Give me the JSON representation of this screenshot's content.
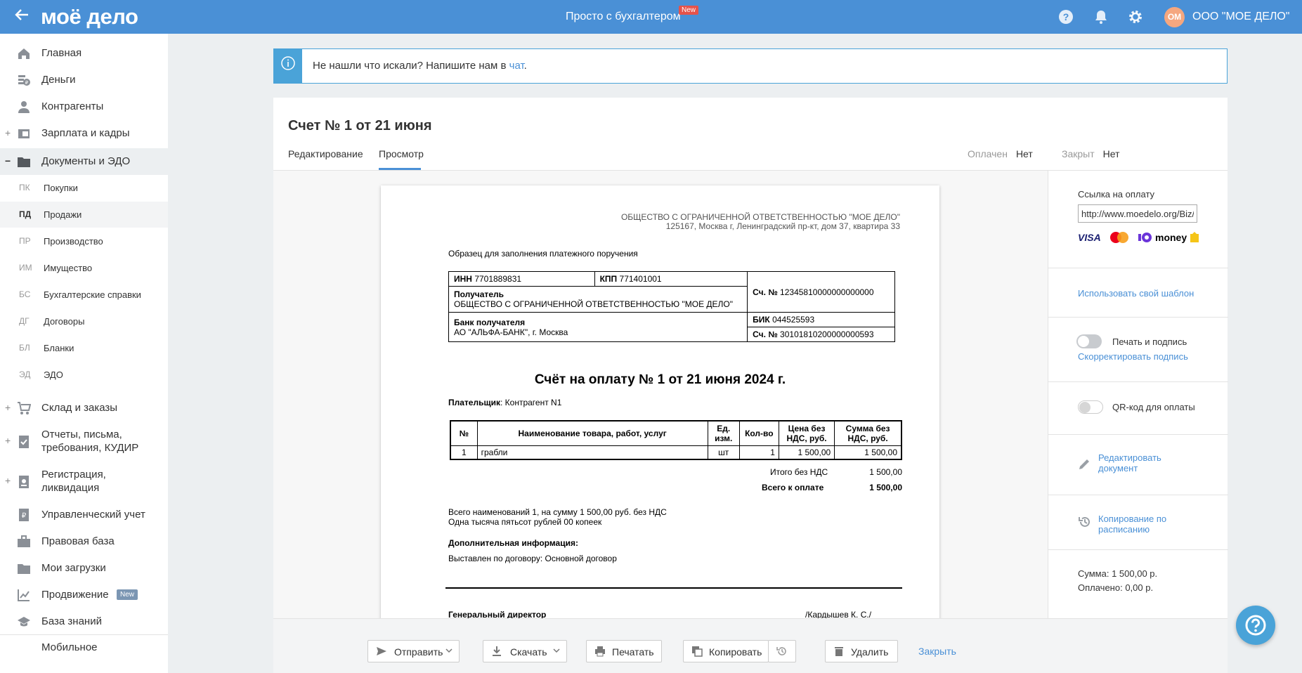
{
  "topbar": {
    "logo": "моё дело",
    "center_text": "Просто с бухгалтером",
    "new_badge": "New",
    "avatar_initials": "ОМ",
    "company": "ООО \"МОЕ ДЕЛО\""
  },
  "sidebar": {
    "items": [
      {
        "label": "Главная"
      },
      {
        "label": "Деньги"
      },
      {
        "label": "Контрагенты"
      },
      {
        "label": "Зарплата и кадры",
        "expander": "+"
      },
      {
        "label": "Документы и ЭДО",
        "expander": "−"
      },
      {
        "label": "Склад и заказы",
        "expander": "+"
      },
      {
        "label_line1": "Отчеты, письма,",
        "label_line2": "требования, КУДИР",
        "expander": "+"
      },
      {
        "label_line1": "Регистрация,",
        "label_line2": "ликвидация",
        "expander": "+"
      },
      {
        "label": "Управленческий учет"
      },
      {
        "label": "Правовая база"
      },
      {
        "label": "Мои загрузки"
      },
      {
        "label": "Продвижение",
        "badge": "New"
      },
      {
        "label": "База знаний"
      },
      {
        "label": "Мобильное"
      }
    ],
    "sub_items": [
      {
        "abbr": "ПК",
        "label": "Покупки"
      },
      {
        "abbr": "ПД",
        "label": "Продажи"
      },
      {
        "abbr": "ПР",
        "label": "Производство"
      },
      {
        "abbr": "ИМ",
        "label": "Имущество"
      },
      {
        "abbr": "БС",
        "label": "Бухгалтерские справки"
      },
      {
        "abbr": "ДГ",
        "label": "Договоры"
      },
      {
        "abbr": "БЛ",
        "label": "Бланки"
      },
      {
        "abbr": "ЭД",
        "label": "ЭДО"
      }
    ]
  },
  "banner": {
    "text": "Не нашли что искали? Напишите нам в ",
    "link": "чат",
    "tail": "."
  },
  "document": {
    "title": "Счет № 1 от 21 июня",
    "tabs": [
      "Редактирование",
      "Просмотр"
    ],
    "paid_label": "Оплачен",
    "paid_value": "Нет",
    "closed_label": "Закрыт",
    "closed_value": "Нет"
  },
  "paper": {
    "org_name": "ОБЩЕСТВО С ОГРАНИЧЕННОЙ ОТВЕТСТВЕННОСТЬЮ \"МОЕ ДЕЛО\"",
    "org_address": "125167, Москва г, Ленинградский пр-кт, дом 37, квартира 33",
    "sample_caption": "Образец для заполнения платежного поручения",
    "inn_label": "ИНН",
    "inn": "7701889831",
    "kpp_label": "КПП",
    "kpp": "771401001",
    "recipient_label": "Получатель",
    "recipient": "ОБЩЕСТВО С ОГРАНИЧЕННОЙ ОТВЕТСТВЕННОСТЬЮ \"МОЕ ДЕЛО\"",
    "account_label": "Сч. №",
    "account": "12345810000000000000",
    "bank_label": "Банк получателя",
    "bank": "АО \"АЛЬФА-БАНК\", г. Москва",
    "bik_label": "БИК",
    "bik": "044525593",
    "corr_account": "30101810200000000593",
    "invoice_title": "Счёт на оплату № 1 от 21 июня 2024 г.",
    "payer_label": "Плательщик",
    "payer": ": Контрагент N1",
    "table_headers": {
      "num": "№",
      "name": "Наименование товара, работ, услуг",
      "unit_l1": "Ед.",
      "unit_l2": "изм.",
      "qty": "Кол-во",
      "price_l1": "Цена без",
      "price_l2": "НДС, руб.",
      "sum_l1": "Сумма без",
      "sum_l2": "НДС, руб."
    },
    "rows": [
      {
        "num": "1",
        "name": "грабли",
        "unit": "шт",
        "qty": "1",
        "price": "1 500,00",
        "sum": "1 500,00"
      }
    ],
    "total_no_vat_label": "Итого без НДС",
    "total_no_vat": "1 500,00",
    "total_due_label": "Всего к оплате",
    "total_due": "1 500,00",
    "summary_line1": "Всего наименований 1, на сумму 1 500,00 руб. без НДС",
    "summary_line2": "Одна тысяча пятьсот рублей 00 копеек",
    "extra_info_label": "Дополнительная информация:",
    "extra_info": "Выставлен по договору: Основной договор",
    "director_label": "Генеральный директор",
    "director_name": "/Кардышев К. С./"
  },
  "right_panel": {
    "payment_link_label": "Ссылка на оплату",
    "payment_link_value": "http://www.moedelo.org/Biz/",
    "pay_brands": [
      "VISA",
      "MasterCard",
      "money"
    ],
    "template_link": "Использовать свой шаблон",
    "print_sign_label": "Печать и подпись",
    "adjust_sign_link": "Скорректировать подпись",
    "qr_label": "QR-код для оплаты",
    "edit_doc_l1": "Редактировать",
    "edit_doc_l2": "документ",
    "schedule_copy_l1": "Копирование по",
    "schedule_copy_l2": "расписанию",
    "sum_line": "Сумма: 1 500,00 р.",
    "paid_line": "Оплачено: 0,00 р."
  },
  "actions": {
    "send": "Отправить",
    "download": "Скачать",
    "print": "Печатать",
    "copy": "Копировать",
    "delete": "Удалить",
    "close": "Закрыть"
  },
  "colors": {
    "topbar": "#4a90d6",
    "accent": "#4aa3d8",
    "link": "#4a90d6",
    "new_badge": "#e5534b",
    "avatar": "#f5a77f"
  }
}
